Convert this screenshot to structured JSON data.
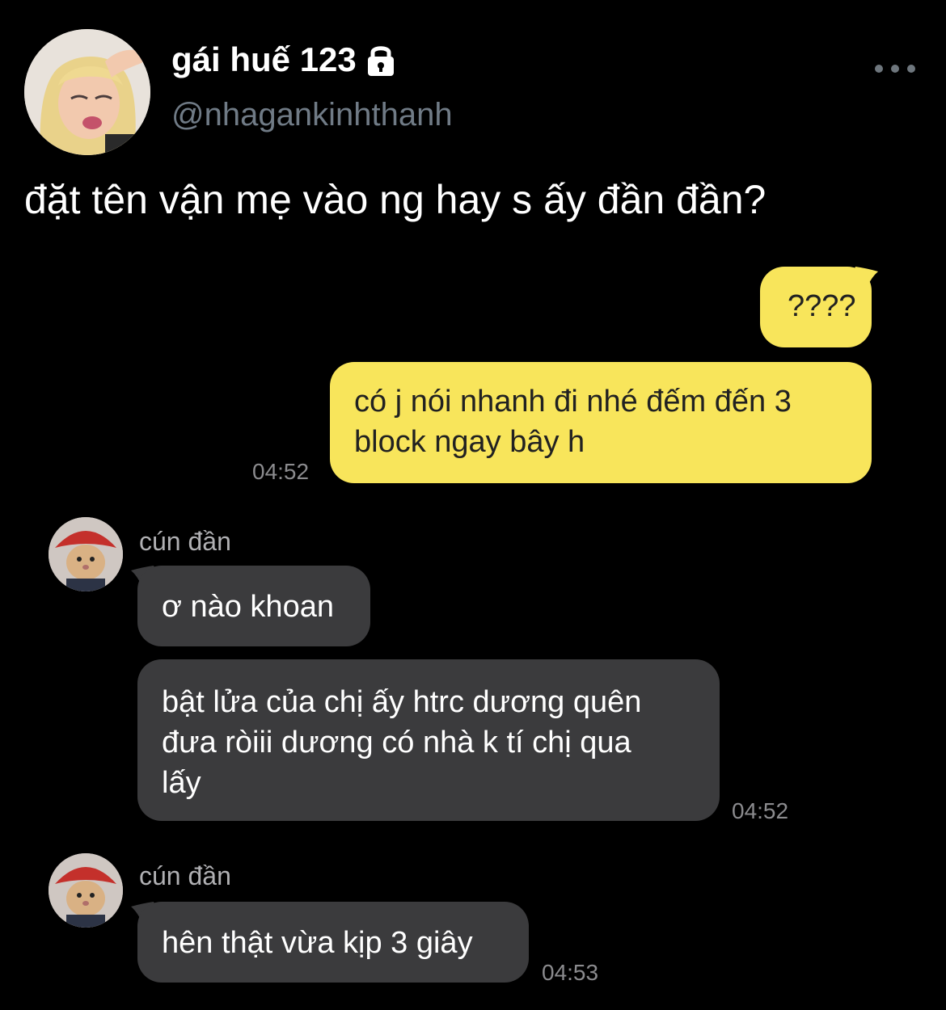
{
  "profile": {
    "display_name": "gái huế 123",
    "handle": "@nhagankinhthanh",
    "avatar_icon": "cartoon-girl-avatar",
    "lock_icon": "lock-icon"
  },
  "tweet": {
    "text": "đặt tên vận mẹ vào ng hay s ấy đần đần?"
  },
  "chat": {
    "colors": {
      "mine_bubble": "#f8e55b",
      "theirs_bubble": "#3b3b3d"
    },
    "messages": [
      {
        "from": "me",
        "text": "????"
      },
      {
        "from": "me",
        "line1": "có j nói nhanh đi nhé đếm đến 3",
        "line2": "block ngay bây h",
        "time": "04:52"
      },
      {
        "from": "them",
        "sender": "cún đần",
        "text": "ơ nào khoan"
      },
      {
        "from": "them",
        "line1": "bật lửa của chị ấy htrc dương quên",
        "line2": "đưa ròiii dương có nhà k tí chị qua",
        "line3": "lấy",
        "time": "04:52"
      },
      {
        "from": "them",
        "sender": "cún đần",
        "text": "hên thật vừa kịp 3 giây",
        "time": "04:53"
      }
    ]
  }
}
